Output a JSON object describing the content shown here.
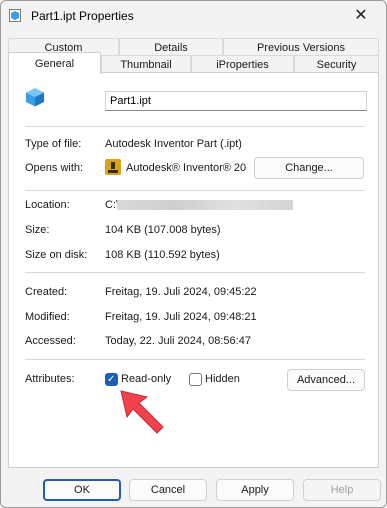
{
  "window": {
    "title": "Part1.ipt Properties",
    "close_glyph": "✕"
  },
  "tabs_back": [
    "Custom",
    "Details",
    "Previous Versions"
  ],
  "tabs_front": [
    "General",
    "Thumbnail",
    "iProperties",
    "Security"
  ],
  "general": {
    "file_name": "Part1.ipt",
    "type_label": "Type of file:",
    "type_value": "Autodesk Inventor Part (.ipt)",
    "opens_label": "Opens with:",
    "opens_value": "Autodesk® Inventor® 20",
    "change_button": "Change...",
    "location_label": "Location:",
    "location_value": "C:\\",
    "size_label": "Size:",
    "size_value": "104 KB (107.008 bytes)",
    "size_disk_label": "Size on disk:",
    "size_disk_value": "108 KB (110.592 bytes)",
    "created_label": "Created:",
    "created_value": "Freitag, 19. Juli 2024, 09:45:22",
    "modified_label": "Modified:",
    "modified_value": "Freitag, 19. Juli 2024, 09:48:21",
    "accessed_label": "Accessed:",
    "accessed_value": "Today, 22. Juli 2024, 08:56:47",
    "attributes_label": "Attributes:",
    "readonly_label": "Read-only",
    "readonly_checked": true,
    "hidden_label": "Hidden",
    "hidden_checked": false,
    "advanced_button": "Advanced..."
  },
  "footer": {
    "ok": "OK",
    "cancel": "Cancel",
    "apply": "Apply",
    "help": "Help"
  },
  "colors": {
    "accent": "#1e5fb4",
    "arrow": "#f0424c",
    "cube": "#3a9ee4"
  },
  "icons": {
    "file_icon": "cube-icon",
    "app_icon": "inventor-app-icon",
    "annotation": "red-arrow-icon"
  }
}
